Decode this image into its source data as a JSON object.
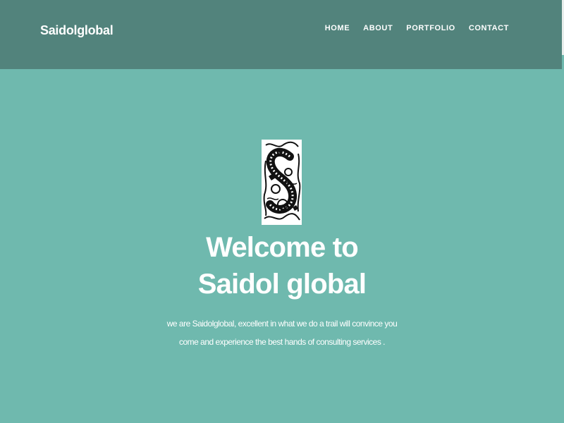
{
  "navbar": {
    "brand": "Saidolglobal",
    "links": [
      {
        "label": "HOME"
      },
      {
        "label": "ABOUT"
      },
      {
        "label": "PORTFOLIO"
      },
      {
        "label": "CONTACT"
      }
    ],
    "background": "#52837c"
  },
  "hero": {
    "logo_icon": "ornate-letter-s-logo",
    "title": "Welcome to Saidol global",
    "text": "we are Saidolglobal, excellent in what we do a trail will convince you come and experience the best hands of consulting services .",
    "background": "#6fb9ae",
    "text_color": "#ffffff"
  }
}
